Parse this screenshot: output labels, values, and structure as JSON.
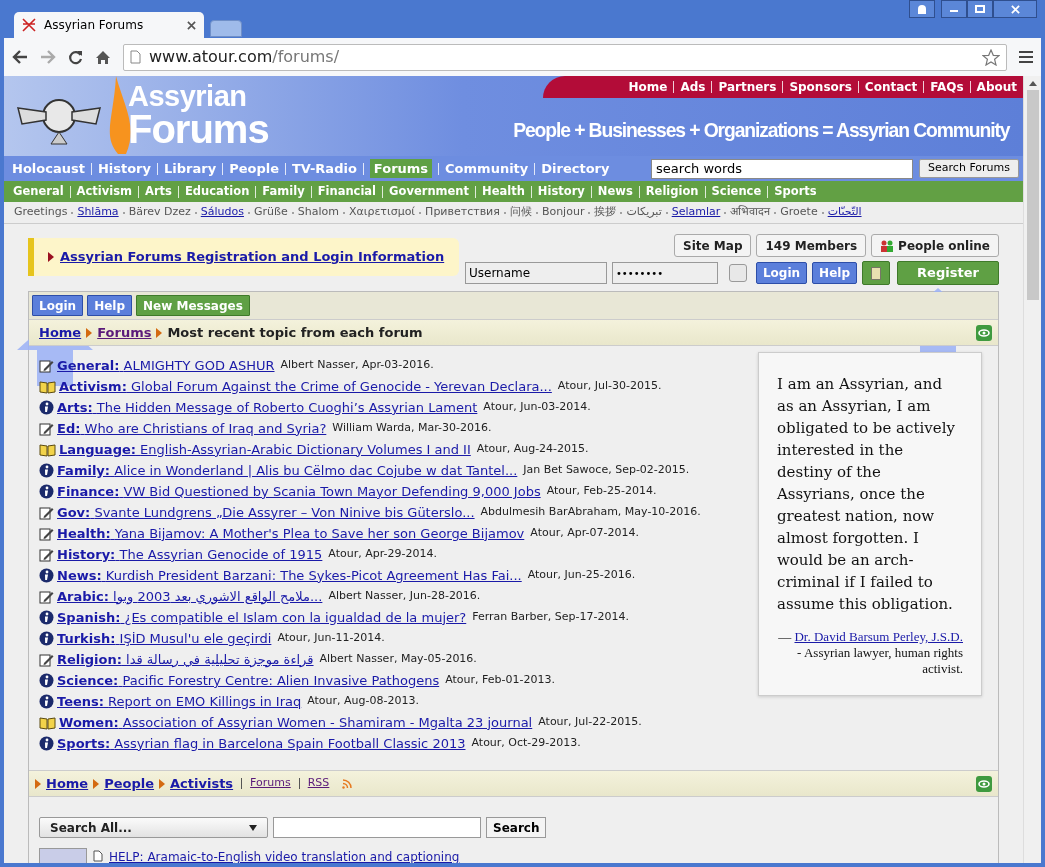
{
  "browser": {
    "tab_title": "Assyrian Forums",
    "url_host": "www.atour.com",
    "url_path": "/forums/"
  },
  "header": {
    "logo_top": "Assyrian",
    "logo_bottom": "Forums",
    "tagline": "People + Businesses + Organizations = Assyrian Community",
    "top_links": [
      "Home",
      "Ads",
      "Partners",
      "Sponsors",
      "Contact",
      "FAQs",
      "About"
    ]
  },
  "main_nav": [
    {
      "label": "Holocaust",
      "selected": false
    },
    {
      "label": "History",
      "selected": false
    },
    {
      "label": "Library",
      "selected": false
    },
    {
      "label": "People",
      "selected": false
    },
    {
      "label": "TV-Radio",
      "selected": false
    },
    {
      "label": "Forums",
      "selected": true
    },
    {
      "label": "Community",
      "selected": false
    },
    {
      "label": "Directory",
      "selected": false
    }
  ],
  "site_search": {
    "value": "search words",
    "button": "Search Forums"
  },
  "categories": [
    "General",
    "Activism",
    "Arts",
    "Education",
    "Family",
    "Financial",
    "Government",
    "Health",
    "History",
    "News",
    "Religion",
    "Science",
    "Sports"
  ],
  "greetings": [
    {
      "text": "Greetings",
      "kind": "text"
    },
    {
      "text": "Shlāma",
      "kind": "link"
    },
    {
      "text": "Bärev Dzez",
      "kind": "text"
    },
    {
      "text": "Sáludos",
      "kind": "link"
    },
    {
      "text": "Grüße",
      "kind": "text"
    },
    {
      "text": "Shalom",
      "kind": "text"
    },
    {
      "text": "Χαιρετισμοί",
      "kind": "text"
    },
    {
      "text": "Приветствия",
      "kind": "text"
    },
    {
      "text": "问候",
      "kind": "text"
    },
    {
      "text": "Bonjour",
      "kind": "text"
    },
    {
      "text": "挨拶",
      "kind": "text"
    },
    {
      "text": "تبريكات",
      "kind": "text"
    },
    {
      "text": "Selamlar",
      "kind": "link"
    },
    {
      "text": "अभिवादन",
      "kind": "text"
    },
    {
      "text": "Groete",
      "kind": "text"
    },
    {
      "text": "التّحيّات",
      "kind": "link"
    }
  ],
  "registration_link": "Assyrian Forums Registration and Login Information",
  "info_buttons": [
    "Site Map",
    "149 Members",
    "People online"
  ],
  "login_form": {
    "username": "Username",
    "password": "••••••••",
    "remember": false,
    "login": "Login",
    "help": "Help",
    "register": "Register"
  },
  "toolbar": [
    {
      "label": "Login",
      "kind": "blue"
    },
    {
      "label": "Help",
      "kind": "blue"
    },
    {
      "label": "New Messages",
      "kind": "green"
    }
  ],
  "breadcrumb": {
    "links": [
      "Home",
      "Forums"
    ],
    "current": "Most recent topic from each forum"
  },
  "forums": [
    {
      "category": "General:",
      "topic": "ALMIGHTY GOD ASHUR",
      "meta": "Albert Nasser, Apr-03-2016.",
      "kind": "edit"
    },
    {
      "category": "Activism:",
      "topic": "Global Forum Against the Crime of Genocide - Yerevan Declara...",
      "meta": "Atour, Jul-30-2015.",
      "kind": "book"
    },
    {
      "category": "Arts:",
      "topic": "The Hidden Message of Roberto Cuoghi’s Assyrian Lament",
      "meta": "Atour, Jun-03-2014.",
      "kind": "info"
    },
    {
      "category": "Ed:",
      "topic": "Who are Christians of Iraq and Syria?",
      "meta": "William Warda, Mar-30-2016.",
      "kind": "edit"
    },
    {
      "category": "Language:",
      "topic": "English-Assyrian-Arabic Dictionary Volumes I and II",
      "meta": "Atour, Aug-24-2015.",
      "kind": "book"
    },
    {
      "category": "Family:",
      "topic": "Alice in Wonderland | Alis bu Cëlmo dac Cojube w dat Tantel...",
      "meta": "Jan Bet Sawoce, Sep-02-2015.",
      "kind": "info"
    },
    {
      "category": "Finance:",
      "topic": "VW Bid Questioned by Scania Town Mayor Defending 9,000 Jobs",
      "meta": "Atour, Feb-25-2014.",
      "kind": "info"
    },
    {
      "category": "Gov:",
      "topic": "Svante Lundgrens „Die Assyrer – Von Ninive bis Güterslo...",
      "meta": "Abdulmesih BarAbraham, May-10-2016.",
      "kind": "edit"
    },
    {
      "category": "Health:",
      "topic": "Yana Bijamov: A Mother's Plea to Save her son George Bijamov",
      "meta": "Atour, Apr-07-2014.",
      "kind": "edit"
    },
    {
      "category": "History:",
      "topic": "The Assyrian Genocide of 1915",
      "meta": "Atour, Apr-29-2014.",
      "kind": "edit"
    },
    {
      "category": "News:",
      "topic": "Kurdish President Barzani: The Sykes-Picot Agreement Has Fai...",
      "meta": "Atour, Jun-25-2016.",
      "kind": "info"
    },
    {
      "category": "Arabic:",
      "topic": "ملامح الواقع الاشوري بعد 2003 وبوا...",
      "meta": "Albert Nasser, Jun-28-2016.",
      "kind": "edit"
    },
    {
      "category": "Spanish:",
      "topic": "¿Es compatible el Islam con la igualdad de la mujer?",
      "meta": "Ferran Barber, Sep-17-2014.",
      "kind": "info"
    },
    {
      "category": "Turkish:",
      "topic": "IŞİD Musul'u ele geçirdi",
      "meta": "Atour, Jun-11-2014.",
      "kind": "info"
    },
    {
      "category": "Religion:",
      "topic": "قراءة موجزة تحليلية في رسالة قدا",
      "meta": "Albert Nasser, May-05-2016.",
      "kind": "edit"
    },
    {
      "category": "Science:",
      "topic": "Pacific Forestry Centre: Alien Invasive Pathogens",
      "meta": "Atour, Feb-01-2013.",
      "kind": "info"
    },
    {
      "category": "Teens:",
      "topic": "Report on EMO Killings in Iraq",
      "meta": "Atour, Aug-08-2013.",
      "kind": "info"
    },
    {
      "category": "Women:",
      "topic": "Association of Assyrian Women - Shamiram - Mgalta 23 journal",
      "meta": "Atour, Jul-22-2015.",
      "kind": "book"
    },
    {
      "category": "Sports:",
      "topic": "Assyrian flag in Barcelona Spain Football Classic 2013",
      "meta": "Atour, Oct-29-2013.",
      "kind": "info"
    }
  ],
  "quote": {
    "text": "I am an Assyrian, and as an Assyrian, I am obligated to be actively interested in the destiny of the Assyrians, once the greatest nation, now almost forgotten. I would be an arch-criminal if I failed to assume this obligation.",
    "dash": "—",
    "author": "Dr. David Barsum Perley, J.S.D.",
    "description": "- Assyrian lawyer, human rights activist."
  },
  "footer_breadcrumb": {
    "links": [
      "Home",
      "People",
      "Activists"
    ],
    "extra_links": [
      "Forums",
      "RSS"
    ]
  },
  "bottom_search": {
    "select": "Search All...",
    "button": "Search"
  },
  "bottom_item": "HELP: Aramaic-to-English video translation and captioning"
}
